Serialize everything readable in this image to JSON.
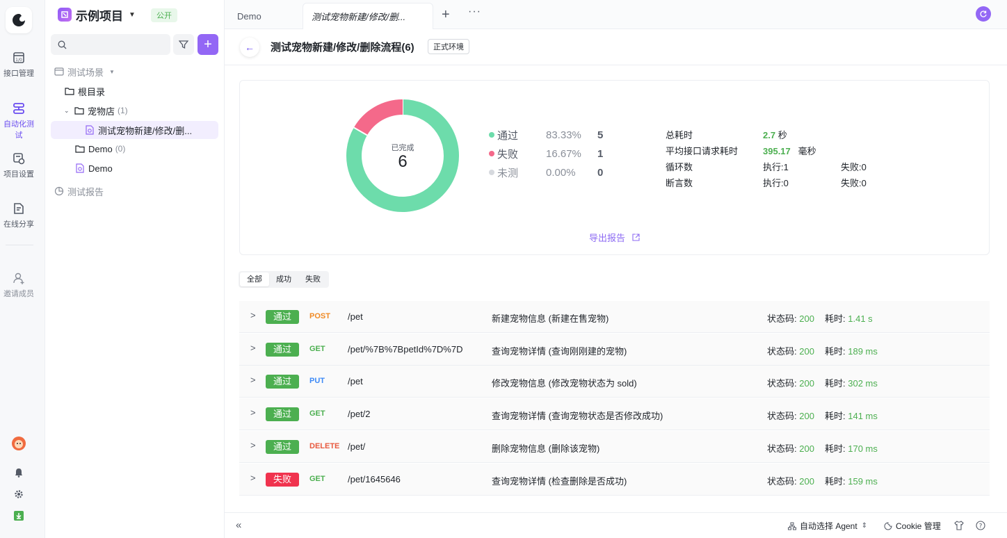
{
  "nav": {
    "items": [
      {
        "label": "接口管理"
      },
      {
        "label": "自动化测试"
      },
      {
        "label": "项目设置"
      },
      {
        "label": "在线分享"
      }
    ],
    "invite": "邀请成员"
  },
  "project": {
    "name": "示例项目",
    "visibility": "公开",
    "search_placeholder": ""
  },
  "tree": {
    "scenes_label": "测试场景",
    "root": "根目录",
    "petstore": {
      "label": "宠物店",
      "count": "(1)"
    },
    "scenario": "测试宠物新建/修改/删...",
    "demo_folder": {
      "label": "Demo",
      "count": "(0)"
    },
    "demo_item": "Demo",
    "reports_label": "测试报告"
  },
  "tabs": [
    {
      "label": "Demo"
    },
    {
      "label": "测试宠物新建/修改/删..."
    }
  ],
  "header": {
    "title": "测试宠物新建/修改/删除流程(6)",
    "env": "正式环境"
  },
  "summary": {
    "center_label": "已完成",
    "center_value": "6",
    "legend": [
      {
        "name": "通过",
        "percent": "83.33%",
        "count": "5",
        "color": "#6ddcab"
      },
      {
        "name": "失败",
        "percent": "16.67%",
        "count": "1",
        "color": "#f4698a"
      },
      {
        "name": "未测",
        "percent": "0.00%",
        "count": "0",
        "color": "#d6d9de"
      }
    ],
    "stats": {
      "total_time_label": "总耗时",
      "total_time_value": "2.7",
      "total_time_unit": "秒",
      "avg_label": "平均接口请求耗时",
      "avg_value": "395.17",
      "avg_unit": "毫秒",
      "loop_label": "循环数",
      "loop_exec": "执行:1",
      "loop_fail": "失败:0",
      "assert_label": "断言数",
      "assert_exec": "执行:0",
      "assert_fail": "失败:0"
    },
    "export_label": "导出报告"
  },
  "filter": [
    "全部",
    "成功",
    "失败"
  ],
  "results": [
    {
      "status": "通过",
      "status_color": "#4caf50",
      "method": "POST",
      "method_color": "#f08a24",
      "path": "/pet",
      "desc": "新建宠物信息 (新建在售宠物)",
      "code_label": "状态码:",
      "code": "200",
      "time_label": "耗时:",
      "time": "1.41 s"
    },
    {
      "status": "通过",
      "status_color": "#4caf50",
      "method": "GET",
      "method_color": "#4caf50",
      "path": "/pet/%7B%7BpetId%7D%7D",
      "desc": "查询宠物详情 (查询刚刚建的宠物)",
      "code_label": "状态码:",
      "code": "200",
      "time_label": "耗时:",
      "time": "189 ms"
    },
    {
      "status": "通过",
      "status_color": "#4caf50",
      "method": "PUT",
      "method_color": "#3d8af7",
      "path": "/pet",
      "desc": "修改宠物信息 (修改宠物状态为 sold)",
      "code_label": "状态码:",
      "code": "200",
      "time_label": "耗时:",
      "time": "302 ms"
    },
    {
      "status": "通过",
      "status_color": "#4caf50",
      "method": "GET",
      "method_color": "#4caf50",
      "path": "/pet/2",
      "desc": "查询宠物详情 (查询宠物状态是否修改成功)",
      "code_label": "状态码:",
      "code": "200",
      "time_label": "耗时:",
      "time": "141 ms"
    },
    {
      "status": "通过",
      "status_color": "#4caf50",
      "method": "DELETE",
      "method_color": "#e85a3f",
      "path": "/pet/",
      "desc": "删除宠物信息 (删除该宠物)",
      "code_label": "状态码:",
      "code": "200",
      "time_label": "耗时:",
      "time": "170 ms"
    },
    {
      "status": "失败",
      "status_color": "#f0334e",
      "method": "GET",
      "method_color": "#4caf50",
      "path": "/pet/1645646",
      "desc": "查询宠物详情 (检查删除是否成功)",
      "code_label": "状态码:",
      "code": "200",
      "time_label": "耗时:",
      "time": "159 ms"
    }
  ],
  "bottom": {
    "agent": "自动选择 Agent",
    "cookie": "Cookie 管理"
  }
}
